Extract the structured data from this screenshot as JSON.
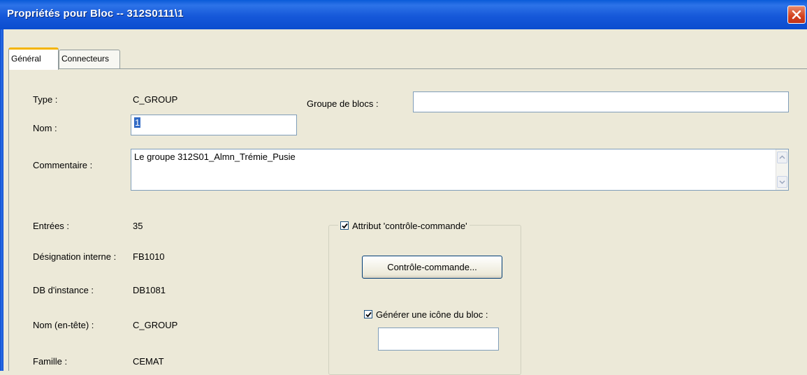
{
  "window": {
    "title": "Propriétés pour Bloc -- 312S0111\\1",
    "close_icon": "close-icon"
  },
  "tabs": [
    {
      "label": "Général",
      "active": true
    },
    {
      "label": "Connecteurs",
      "active": false
    }
  ],
  "form": {
    "type_label": "Type :",
    "type_value": "C_GROUP",
    "groupe_label": "Groupe de blocs :",
    "groupe_value": "",
    "nom_label": "Nom :",
    "nom_value": "1",
    "commentaire_label": "Commentaire :",
    "commentaire_value": "Le groupe 312S01_Almn_Trémie_Pusie",
    "entrees_label": "Entrées :",
    "entrees_value": "35",
    "designation_label": "Désignation interne :",
    "designation_value": "FB1010",
    "db_label": "DB d'instance :",
    "db_value": "DB1081",
    "nom_entete_label": "Nom (en-tête) :",
    "nom_entete_value": "C_GROUP",
    "famille_label": "Famille :",
    "famille_value": "CEMAT"
  },
  "cc_group": {
    "attribut_label": "Attribut 'contrôle-commande'",
    "attribut_checked": true,
    "cc_button_label": "Contrôle-commande...",
    "generer_label": "Générer une icône du bloc :",
    "generer_checked": true,
    "icon_value": ""
  },
  "colors": {
    "title_blue": "#0b4ccf",
    "dialog_bg": "#ece9d8",
    "tab_highlight": "#f4b400",
    "close_red": "#d3411d"
  }
}
